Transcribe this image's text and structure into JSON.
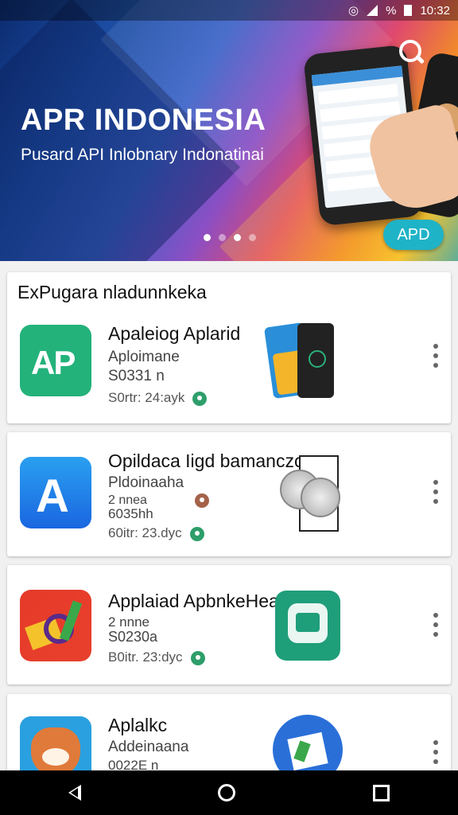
{
  "status_bar": {
    "time": "10:32",
    "battery_text": "%"
  },
  "banner": {
    "title": "APR INDONESIA",
    "subtitle": "Pusard API Inlobnary Indonatinai",
    "button_label": "APD",
    "pager": {
      "count": 4,
      "active": [
        0,
        2
      ]
    }
  },
  "section": {
    "title": "ExPugara nladunnkeka"
  },
  "apps": [
    {
      "name": "Apaleiog Aplarid",
      "lines": [
        "Aploimane",
        "S0331 n"
      ],
      "meta": "S0rtr: 24:ayk",
      "icon": "ap-logo-icon",
      "thumb": "phone-preview-icon"
    },
    {
      "name": "Opildaca Iigd bamanczcnr",
      "lines": [
        "Pldoinaaha",
        "2 nnea",
        "6035hh"
      ],
      "meta": "60itr: 23.dyc",
      "icon": "letter-a-icon",
      "thumb": "clock-icon"
    },
    {
      "name": "Applaiad ApbnkeHea",
      "lines": [
        "2 nnne",
        "S0230a"
      ],
      "meta": "B0itr. 23:dyc",
      "icon": "colorful-logo-icon",
      "thumb": "chat-app-icon"
    },
    {
      "name": "Aplalkc",
      "lines": [
        "Addeinaana",
        "0022E n"
      ],
      "meta": "",
      "icon": "fox-mascot-icon",
      "thumb": "map-icon"
    }
  ],
  "nav": {
    "back": "back-icon",
    "home": "home-icon",
    "recent": "recent-apps-icon"
  }
}
